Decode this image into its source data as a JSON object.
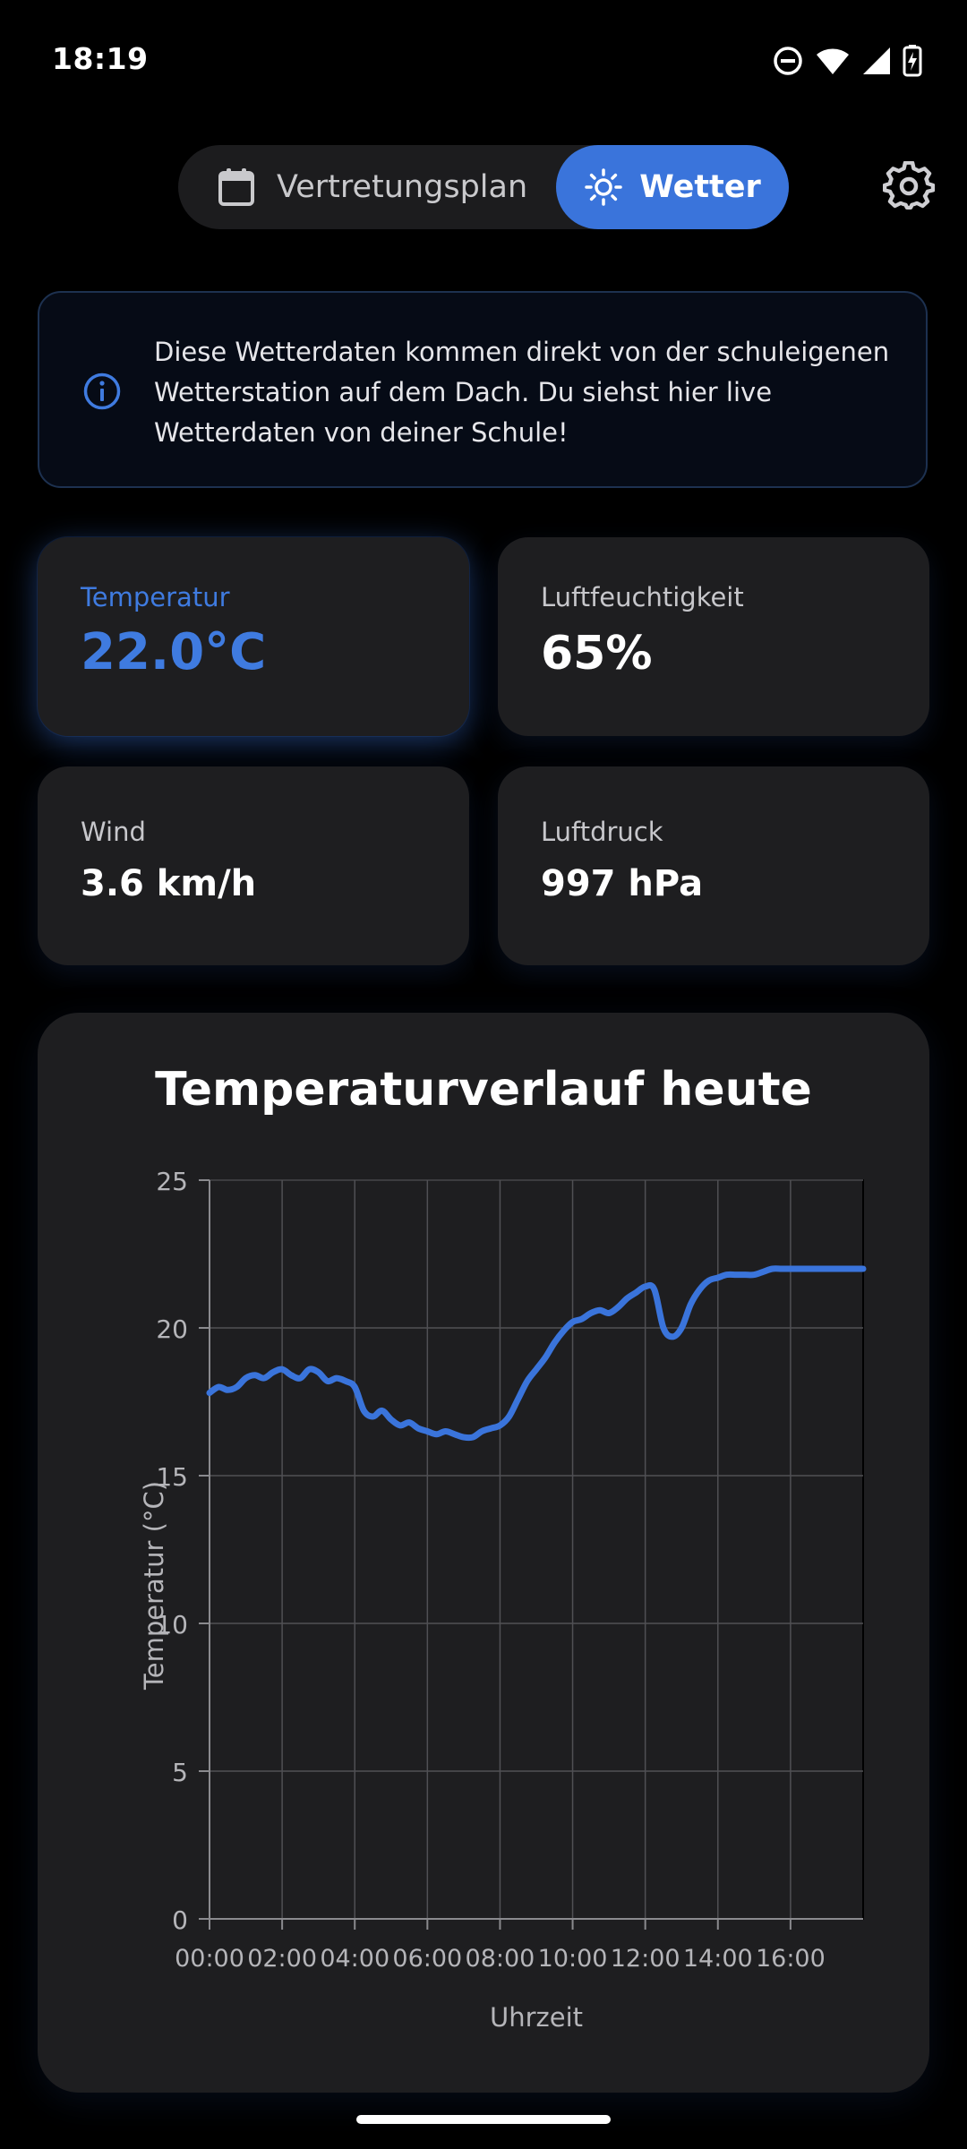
{
  "status_bar": {
    "time": "18:19"
  },
  "tabs": [
    {
      "label": "Vertretungsplan",
      "icon": "calendar-icon",
      "active": false
    },
    {
      "label": "Wetter",
      "icon": "sun-icon",
      "active": true
    }
  ],
  "info": {
    "text": "Diese Wetterdaten kommen direkt von der schuleigenen Wetterstation auf dem Dach. Du siehst hier live Wetterdaten von deiner Schule!"
  },
  "metrics": {
    "temperature": {
      "label": "Temperatur",
      "value": "22.0°C"
    },
    "humidity": {
      "label": "Luftfeuchtigkeit",
      "value": "65%"
    },
    "wind": {
      "label": "Wind",
      "value": "3.6 km/h"
    },
    "pressure": {
      "label": "Luftdruck",
      "value": "997 hPa"
    }
  },
  "colors": {
    "accent": "#3a74db",
    "card": "#1e1e20",
    "background": "#000000"
  },
  "chart_data": {
    "type": "line",
    "title": "Temperaturverlauf heute",
    "xlabel": "Uhrzeit",
    "ylabel": "Temperatur (°C)",
    "xlim": [
      0,
      18
    ],
    "ylim": [
      0,
      25
    ],
    "grid": true,
    "x_tick_values": [
      0,
      2,
      4,
      6,
      8,
      10,
      12,
      14,
      16
    ],
    "x_tick_labels": [
      "00:00",
      "02:00",
      "04:00",
      "06:00",
      "08:00",
      "10:00",
      "12:00",
      "14:00",
      "16:00"
    ],
    "y_tick_values": [
      0,
      5,
      10,
      15,
      20,
      25
    ],
    "y_tick_labels": [
      "0",
      "5",
      "10",
      "15",
      "20",
      "25"
    ],
    "series": [
      {
        "x": [
          0,
          0.25,
          0.5,
          0.75,
          1.0,
          1.25,
          1.5,
          1.75,
          2.0,
          2.25,
          2.5,
          2.75,
          3.0,
          3.25,
          3.5,
          3.75,
          4.0,
          4.25,
          4.5,
          4.75,
          5.0,
          5.25,
          5.5,
          5.75,
          6.0,
          6.25,
          6.5,
          6.75,
          7.0,
          7.25,
          7.5,
          7.75,
          8.0,
          8.25,
          8.5,
          8.75,
          9.0,
          9.25,
          9.5,
          9.75,
          10.0,
          10.25,
          10.5,
          10.75,
          11.0,
          11.25,
          11.5,
          11.75,
          12.0,
          12.25,
          12.5,
          12.75,
          13.0,
          13.25,
          13.5,
          13.75,
          14.0,
          14.25,
          14.5,
          14.75,
          15.0,
          15.25,
          15.5,
          15.75,
          16.0,
          16.5,
          17.0,
          17.5,
          18.0
        ],
        "values": [
          17.8,
          18.0,
          17.9,
          18.0,
          18.3,
          18.4,
          18.3,
          18.5,
          18.6,
          18.4,
          18.3,
          18.6,
          18.5,
          18.2,
          18.3,
          18.2,
          18.0,
          17.2,
          17.0,
          17.2,
          16.9,
          16.7,
          16.8,
          16.6,
          16.5,
          16.4,
          16.5,
          16.4,
          16.3,
          16.3,
          16.5,
          16.6,
          16.7,
          17.0,
          17.6,
          18.2,
          18.6,
          19.0,
          19.5,
          19.9,
          20.2,
          20.3,
          20.5,
          20.6,
          20.5,
          20.7,
          21.0,
          21.2,
          21.4,
          21.3,
          20.0,
          19.7,
          20.0,
          20.8,
          21.3,
          21.6,
          21.7,
          21.8,
          21.8,
          21.8,
          21.8,
          21.9,
          22.0,
          22.0,
          22.0,
          22.0,
          22.0,
          22.0,
          22.0
        ]
      }
    ]
  }
}
